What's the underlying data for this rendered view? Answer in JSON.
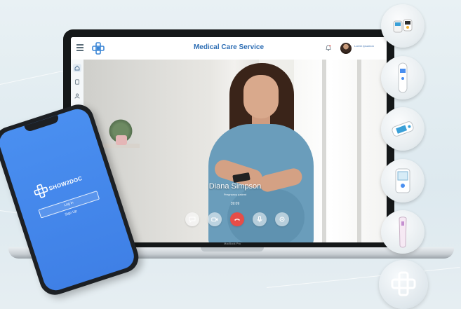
{
  "app": {
    "title": "Medical Care Service",
    "user_name": "Lorem Ipsumon"
  },
  "sidebar": {
    "items": [
      {
        "icon": "home-icon"
      },
      {
        "icon": "document-icon"
      },
      {
        "icon": "users-icon"
      },
      {
        "icon": "device-icon"
      }
    ]
  },
  "call": {
    "caller_name": "Diana Simpson",
    "caller_role": "Pregnancy patient",
    "timer": "39:09",
    "controls": [
      "chat-icon",
      "video-icon",
      "end-call-icon",
      "microphone-icon",
      "settings-icon"
    ]
  },
  "laptop": {
    "label": "MacBook Pro"
  },
  "phone": {
    "brand": "SHOW2DOC",
    "login_label": "Log in",
    "signup_label": "Sign Up"
  },
  "devices": [
    "blood-glucose-meter-icon",
    "thermometer-icon",
    "pulse-oximeter-icon",
    "blood-pressure-monitor-icon",
    "fetal-doppler-icon",
    "medical-cross-icon"
  ],
  "colors": {
    "brand_blue": "#2e6eb4",
    "phone_blue": "#4a8ff0",
    "end_call_red": "#e64d48"
  }
}
